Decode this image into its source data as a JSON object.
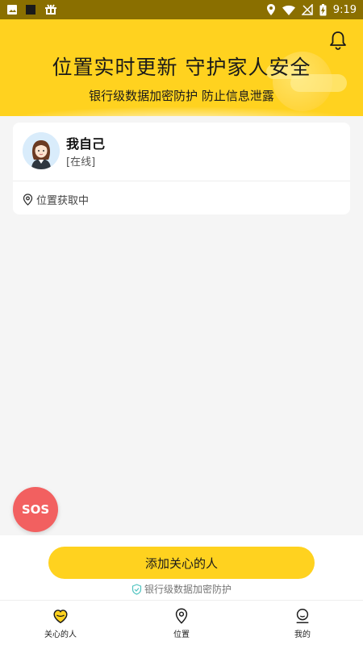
{
  "status_bar": {
    "time": "9:19"
  },
  "header": {
    "title": "位置实时更新 守护家人安全",
    "subtitle": "银行级数据加密防护 防止信息泄露"
  },
  "card": {
    "name": "我自己",
    "status": "[在线]",
    "location": "位置获取中"
  },
  "sos": {
    "label": "SOS"
  },
  "bottom": {
    "add_button": "添加关心的人",
    "secure_note": "银行级数据加密防护"
  },
  "tabs": [
    {
      "label": "关心的人",
      "icon": "heart-icon",
      "active": true
    },
    {
      "label": "位置",
      "icon": "location-pin-icon",
      "active": false
    },
    {
      "label": "我的",
      "icon": "profile-icon",
      "active": false
    }
  ],
  "colors": {
    "accent": "#ffd21f",
    "status_bar": "#8a6f00",
    "sos": "#f26060"
  }
}
